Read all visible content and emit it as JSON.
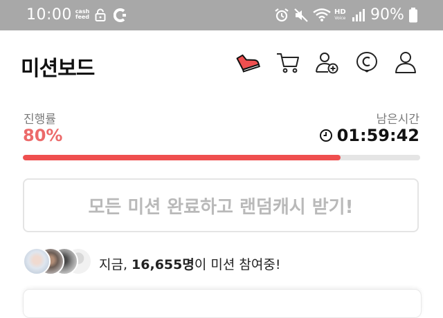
{
  "status_bar": {
    "time": "10:00",
    "cashfeed_line1": "cash",
    "cashfeed_line2": "feed",
    "hd_label": "HD",
    "voice_label": "Voice",
    "battery": "90%"
  },
  "header": {
    "title": "미션보드",
    "icons": [
      "sneaker-icon",
      "cart-icon",
      "add-friend-icon",
      "coin-icon",
      "profile-icon"
    ],
    "accent_color": "#ef4f4f"
  },
  "progress": {
    "label": "진행률",
    "value_text": "80%",
    "fraction": 0.8,
    "remaining_label": "남은시간",
    "remaining_time": "01:59:42"
  },
  "cta": {
    "label": "모든 미션 완료하고 랜덤캐시 받기!"
  },
  "participants": {
    "prefix": "지금, ",
    "count": "16,655명",
    "suffix": "이 미션 참여중!"
  }
}
